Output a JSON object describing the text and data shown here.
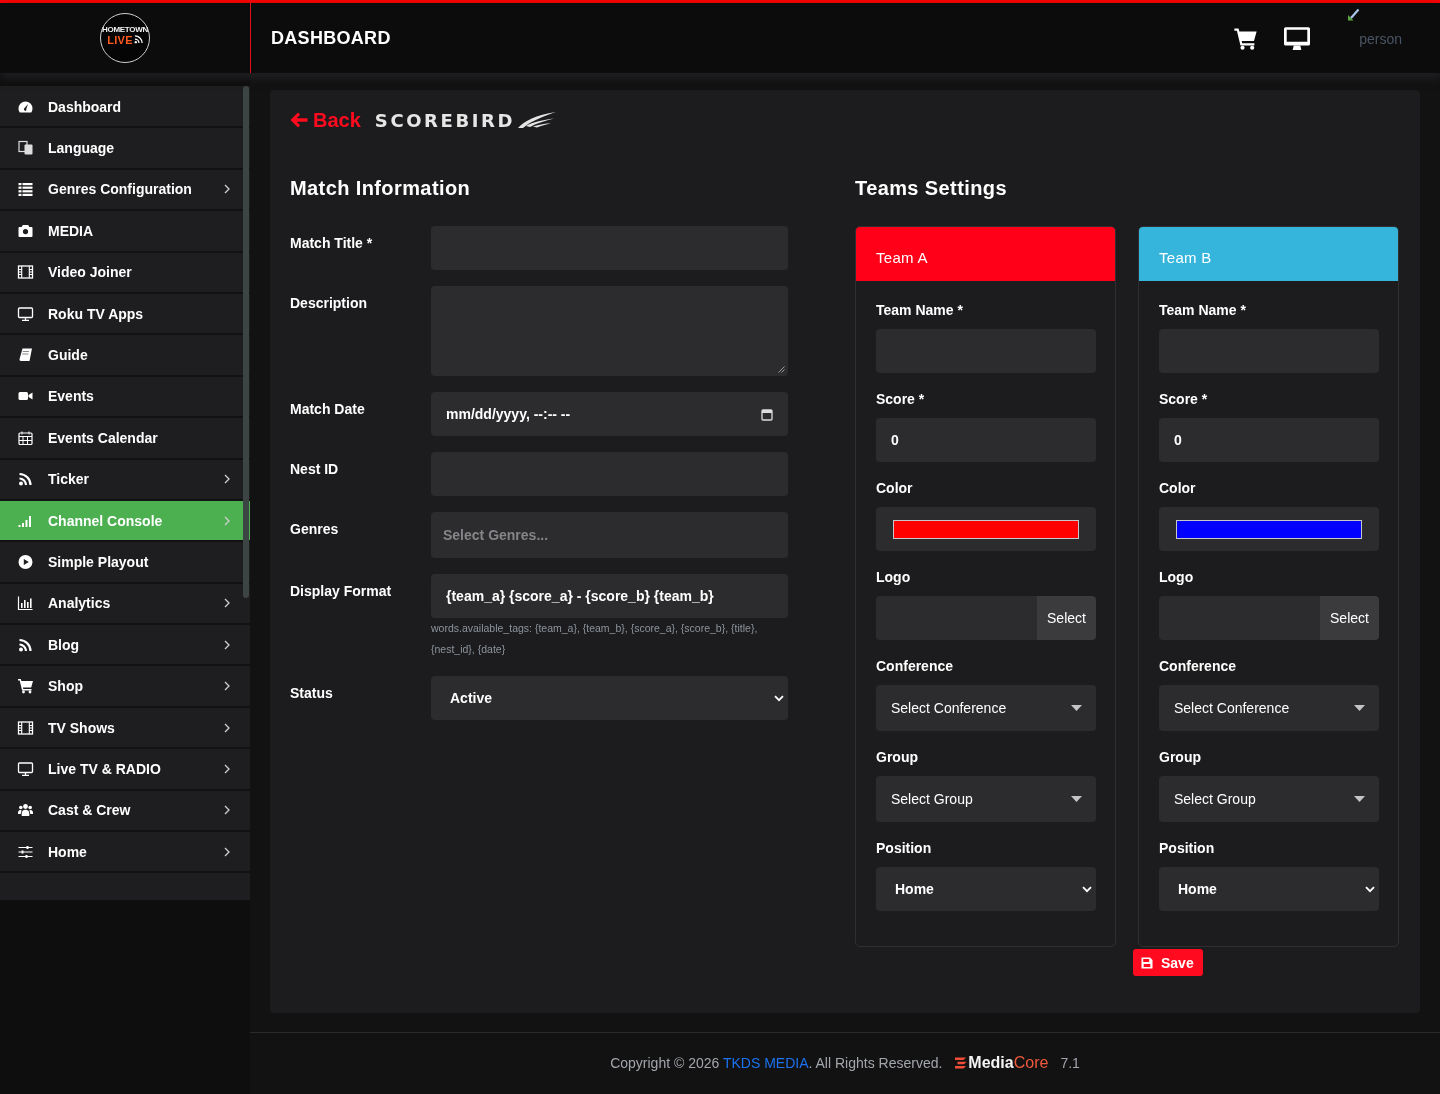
{
  "header": {
    "logo": {
      "top": "HOMETOWN",
      "bottom": "LIVE"
    },
    "title": "DASHBOARD",
    "user_label": "person"
  },
  "sidebar": {
    "items": [
      {
        "label": "Dashboard",
        "has_submenu": false,
        "selected": false
      },
      {
        "label": "Language",
        "has_submenu": false,
        "selected": false
      },
      {
        "label": "Genres Configuration",
        "has_submenu": true,
        "selected": false
      },
      {
        "label": "MEDIA",
        "has_submenu": false,
        "selected": false
      },
      {
        "label": "Video Joiner",
        "has_submenu": false,
        "selected": false
      },
      {
        "label": "Roku TV Apps",
        "has_submenu": false,
        "selected": false
      },
      {
        "label": "Guide",
        "has_submenu": false,
        "selected": false
      },
      {
        "label": "Events",
        "has_submenu": false,
        "selected": false
      },
      {
        "label": "Events Calendar",
        "has_submenu": false,
        "selected": false
      },
      {
        "label": "Ticker",
        "has_submenu": true,
        "selected": false
      },
      {
        "label": "Channel Console",
        "has_submenu": true,
        "selected": true
      },
      {
        "label": "Simple Playout",
        "has_submenu": false,
        "selected": false
      },
      {
        "label": "Analytics",
        "has_submenu": true,
        "selected": false
      },
      {
        "label": "Blog",
        "has_submenu": true,
        "selected": false
      },
      {
        "label": "Shop",
        "has_submenu": true,
        "selected": false
      },
      {
        "label": "TV Shows",
        "has_submenu": true,
        "selected": false
      },
      {
        "label": "Live TV & RADIO",
        "has_submenu": true,
        "selected": false
      },
      {
        "label": "Cast & Crew",
        "has_submenu": true,
        "selected": false
      },
      {
        "label": "Home",
        "has_submenu": true,
        "selected": false
      }
    ]
  },
  "page": {
    "back": "Back",
    "brand": "SCOREBIRD"
  },
  "match_information": {
    "title": "Match Information",
    "fields": [
      {
        "kind": "text",
        "label": "Match Title *"
      },
      {
        "kind": "textarea",
        "label": "Description"
      },
      {
        "kind": "datetime",
        "label": "Match Date",
        "value": "mm/dd/yyyy, --:-- --"
      },
      {
        "kind": "text",
        "label": "Nest ID"
      },
      {
        "kind": "multiselect",
        "label": "Genres",
        "placeholder": "Select Genres..."
      },
      {
        "kind": "text",
        "label": "Display Format",
        "value": "{team_a} {score_a} - {score_b} {team_b}",
        "help": "words.available_tags: {team_a}, {team_b}, {score_a}, {score_b}, {title}, {nest_id}, {date}"
      },
      {
        "kind": "select",
        "label": "Status",
        "value": "Active"
      }
    ]
  },
  "teams_settings": {
    "title": "Teams Settings",
    "teams": [
      {
        "name": "Team A",
        "color": "#ff0018",
        "fields": [
          {
            "kind": "text",
            "label": "Team Name *"
          },
          {
            "kind": "text",
            "label": "Score *",
            "value": "0"
          },
          {
            "kind": "color",
            "label": "Color",
            "color": "#ff0000"
          },
          {
            "kind": "file",
            "label": "Logo",
            "button": "Select"
          },
          {
            "kind": "dropdown",
            "label": "Conference",
            "value": "Select Conference"
          },
          {
            "kind": "dropdown",
            "label": "Group",
            "value": "Select Group"
          },
          {
            "kind": "select",
            "label": "Position",
            "value": "Home"
          }
        ]
      },
      {
        "name": "Team B",
        "color": "#35b5dc",
        "fields": [
          {
            "kind": "text",
            "label": "Team Name *"
          },
          {
            "kind": "text",
            "label": "Score *",
            "value": "0"
          },
          {
            "kind": "color",
            "label": "Color",
            "color": "#0000ff"
          },
          {
            "kind": "file",
            "label": "Logo",
            "button": "Select"
          },
          {
            "kind": "dropdown",
            "label": "Conference",
            "value": "Select Conference"
          },
          {
            "kind": "dropdown",
            "label": "Group",
            "value": "Select Group"
          },
          {
            "kind": "select",
            "label": "Position",
            "value": "Home"
          }
        ]
      }
    ]
  },
  "save_button": {
    "label": "Save"
  },
  "footer": {
    "copyright_before": "Copyright © 2026",
    "company": "TKDS MEDIA",
    "copyright_after": ". All Rights Reserved.",
    "brand": {
      "first": "Media",
      "second": "Core"
    },
    "version": "7.1"
  }
}
